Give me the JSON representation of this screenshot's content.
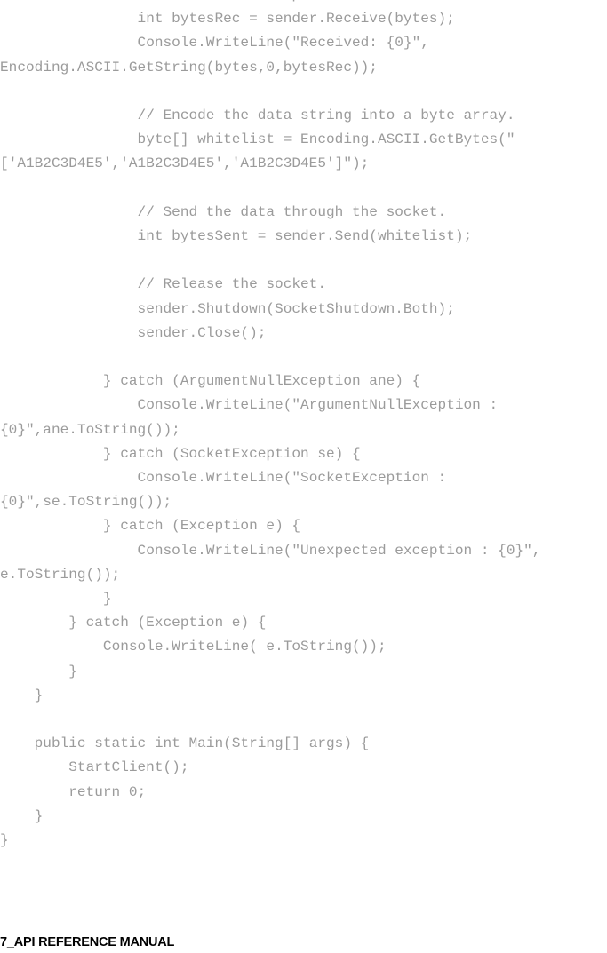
{
  "document": {
    "page_label": "7_API REFERENCE MANUAL",
    "text_color": "#9b9b9b",
    "footer_color": "#000000",
    "background": "#ffffff"
  },
  "code": {
    "language": "csharp",
    "lines": [
      "                // Receive the response from the remote device.",
      "                int bytesRec = sender.Receive(bytes);",
      "                Console.WriteLine(\"Received: {0}\", Encoding.ASCII.GetString(bytes,0,bytesRec));",
      "",
      "                // Encode the data string into a byte array.",
      "                byte[] whitelist = Encoding.ASCII.GetBytes(\"['A1B2C3D4E5','A1B2C3D4E5','A1B2C3D4E5']\");",
      "",
      "                // Send the data through the socket.",
      "                int bytesSent = sender.Send(whitelist);",
      "",
      "                // Release the socket.",
      "                sender.Shutdown(SocketShutdown.Both);",
      "                sender.Close();",
      "",
      "            } catch (ArgumentNullException ane) {",
      "                Console.WriteLine(\"ArgumentNullException : {0}\",ane.ToString());",
      "            } catch (SocketException se) {",
      "                Console.WriteLine(\"SocketException : {0}\",se.ToString());",
      "            } catch (Exception e) {",
      "                Console.WriteLine(\"Unexpected exception : {0}\", e.ToString());",
      "            }",
      "        } catch (Exception e) {",
      "            Console.WriteLine( e.ToString());",
      "        }",
      "    }",
      "",
      "    public static int Main(String[] args) {",
      "        StartClient();",
      "        return 0;",
      "    }",
      "}"
    ]
  }
}
